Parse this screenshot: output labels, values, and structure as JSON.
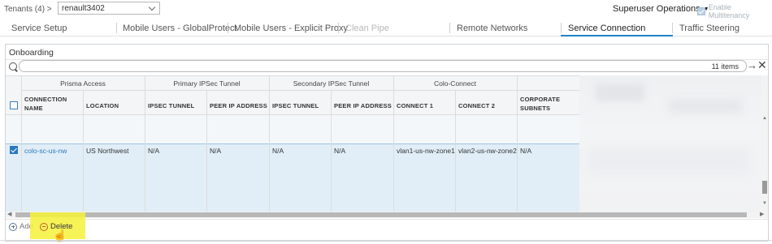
{
  "header": {
    "tenants_label": "Tenants (4) >",
    "tenant_value": "renault3402",
    "superuser_label": "Superuser Operations",
    "multitenancy_label": "Enable Multitenancy"
  },
  "tabs": [
    {
      "label": "Service Setup"
    },
    {
      "label": "Mobile Users - GlobalProtect"
    },
    {
      "label": "Mobile Users - Explicit Proxy"
    },
    {
      "label": "Clean Pipe"
    },
    {
      "label": "Remote Networks"
    },
    {
      "label": "Service Connection"
    },
    {
      "label": "Traffic Steering"
    }
  ],
  "active_tab": "Service Connection",
  "panel": {
    "title": "Onboarding",
    "search_placeholder": "",
    "items_count": "11 items"
  },
  "table": {
    "groups": [
      "Prisma Access",
      "Primary IPSec Tunnel",
      "Secondary IPSec Tunnel",
      "Colo-Connect"
    ],
    "columns": [
      {
        "line1": "CONNECTION",
        "line2": "NAME"
      },
      {
        "line1": "LOCATION",
        "line2": ""
      },
      {
        "line1": "IPSEC TUNNEL",
        "line2": ""
      },
      {
        "line1": "PEER IP ADDRESS",
        "line2": ""
      },
      {
        "line1": "IPSEC TUNNEL",
        "line2": ""
      },
      {
        "line1": "PEER IP ADDRESS",
        "line2": ""
      },
      {
        "line1": "CONNECT 1",
        "line2": ""
      },
      {
        "line1": "CONNECT 2",
        "line2": ""
      },
      {
        "line1": "CORPORATE",
        "line2": "SUBNETS"
      }
    ],
    "rows": [
      {
        "checked": true,
        "cells": [
          "colo-sc-us-nw",
          "US Northwest",
          "N/A",
          "N/A",
          "N/A",
          "N/A",
          "vlan1-us-nw-zone1",
          "vlan2-us-nw-zone2",
          "N/A"
        ]
      }
    ]
  },
  "actions": {
    "add_label": "Add",
    "delete_label": "Delete"
  },
  "colors": {
    "accent": "#1f83c6",
    "selected_row": "#e1eef7",
    "highlight": "#f4f13a",
    "link": "#2a78c2"
  }
}
